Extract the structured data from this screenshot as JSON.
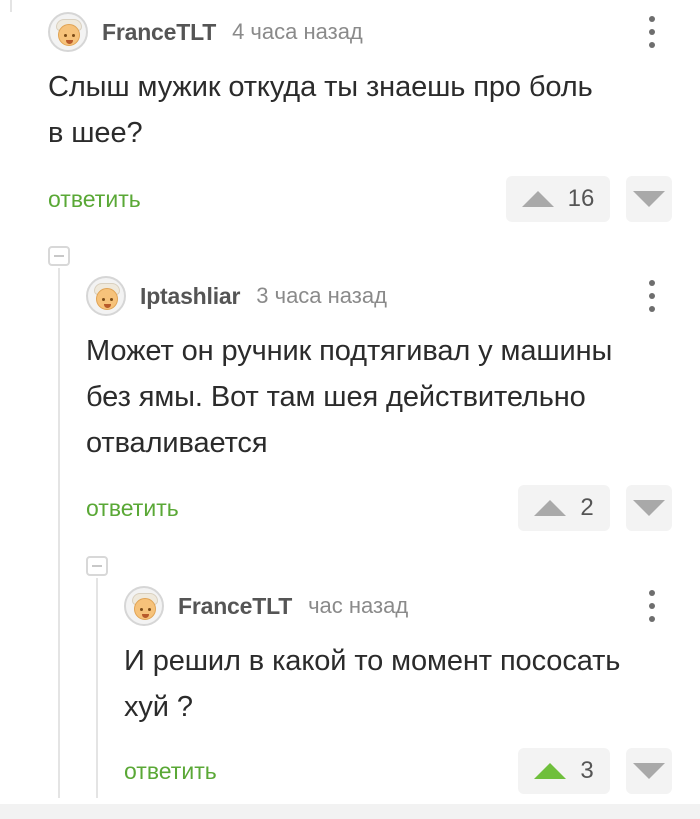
{
  "comments": [
    {
      "username": "FranceTLT",
      "time": "4 часа назад",
      "text_lines": [
        "Слыш мужик откуда ты знаешь про боль",
        "в шее?"
      ],
      "reply": "ответить",
      "votes": "16",
      "upvoted": false
    },
    {
      "username": "Iptashliar",
      "time": "3 часа назад",
      "text_lines": [
        "Может он ручник подтягивал у машины",
        "без ямы. Вот там шея действительно",
        "отваливается"
      ],
      "reply": "ответить",
      "votes": "2",
      "upvoted": false
    },
    {
      "username": "FranceTLT",
      "time": "час назад",
      "text_lines": [
        "И решил в какой то момент пососать",
        "хуй ?"
      ],
      "reply": "ответить",
      "votes": "3",
      "upvoted": true
    }
  ],
  "colors": {
    "reply_link": "#5aa836",
    "upvote_active": "#6fbf3c",
    "vote_icon": "#a9a9a9",
    "vote_box": "#f3f3f3"
  },
  "icons": {
    "more": "more-vertical-icon",
    "up": "arrow-up-icon",
    "down": "arrow-down-icon",
    "collapse": "collapse-minus-icon"
  }
}
